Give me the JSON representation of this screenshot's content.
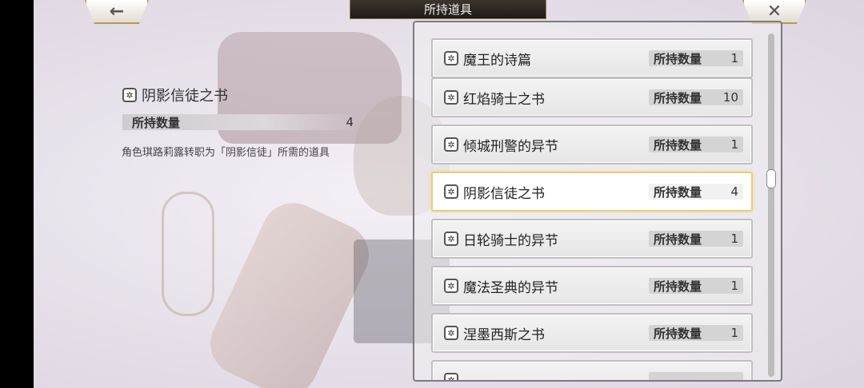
{
  "header": {
    "title": "所持道具",
    "back_icon": "←",
    "close_icon": "✕"
  },
  "detail": {
    "name": "阴影信徒之书",
    "count_label": "所持数量",
    "count": "4",
    "description": "角色琪路莉露转职为「阴影信徒」所需的道具"
  },
  "items": [
    {
      "name": "魔王的诗篇",
      "count_label": "所持数量",
      "count": "1"
    },
    {
      "name": "红焰骑士之书",
      "count_label": "所持数量",
      "count": "10"
    },
    {
      "name": "倾城刑警的异节",
      "count_label": "所持数量",
      "count": "1"
    },
    {
      "name": "阴影信徒之书",
      "count_label": "所持数量",
      "count": "4",
      "selected": true
    },
    {
      "name": "日轮骑士的异节",
      "count_label": "所持数量",
      "count": "1"
    },
    {
      "name": "魔法圣典的异节",
      "count_label": "所持数量",
      "count": "1"
    },
    {
      "name": "涅墨西斯之书",
      "count_label": "所持数量",
      "count": "1"
    },
    {
      "name": "",
      "count_label": "",
      "count": ""
    }
  ],
  "icons": {
    "book_glyph": "✲"
  },
  "colors": {
    "selected_border": "#e8cd7a",
    "title_plate": "#2b2620",
    "frame_gold": "#b69a52"
  }
}
